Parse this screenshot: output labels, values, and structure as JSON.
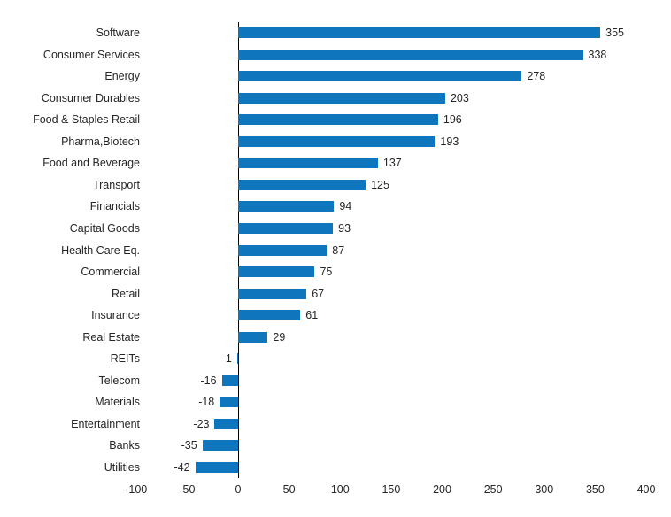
{
  "chart_data": {
    "type": "bar",
    "orientation": "horizontal",
    "title": "",
    "subtitle": "",
    "xlabel": "",
    "ylabel": "",
    "xlim": [
      -100,
      400
    ],
    "xticks": [
      -100,
      -50,
      0,
      50,
      100,
      150,
      200,
      250,
      300,
      350,
      400
    ],
    "xtick_labels": [
      "-100",
      "-50",
      "0",
      "50",
      "100",
      "150",
      "200",
      "250",
      "300",
      "350",
      "400"
    ],
    "grid": false,
    "legend": null,
    "bar_color": "#0f75bc",
    "axis_color": "#000000",
    "text_color": "#262626",
    "categories": [
      "Software",
      "Consumer Services",
      "Energy",
      "Consumer Durables",
      "Food & Staples Retail",
      "Pharma,Biotech",
      "Food and Beverage",
      "Transport",
      "Financials",
      "Capital Goods",
      "Health Care Eq.",
      "Commercial",
      "Retail",
      "Insurance",
      "Real Estate",
      "REITs",
      "Telecom",
      "Materials",
      "Entertainment",
      "Banks",
      "Utilities"
    ],
    "values": [
      355,
      338,
      278,
      203,
      196,
      193,
      137,
      125,
      94,
      93,
      87,
      75,
      67,
      61,
      29,
      -1,
      -16,
      -18,
      -23,
      -35,
      -42
    ],
    "data_labels": [
      "355",
      "338",
      "278",
      "203",
      "196",
      "193",
      "137",
      "125",
      "94",
      "93",
      "87",
      "75",
      "67",
      "61",
      "29",
      "-1",
      "-16",
      "-18",
      "-23",
      "-35",
      "-42"
    ]
  }
}
